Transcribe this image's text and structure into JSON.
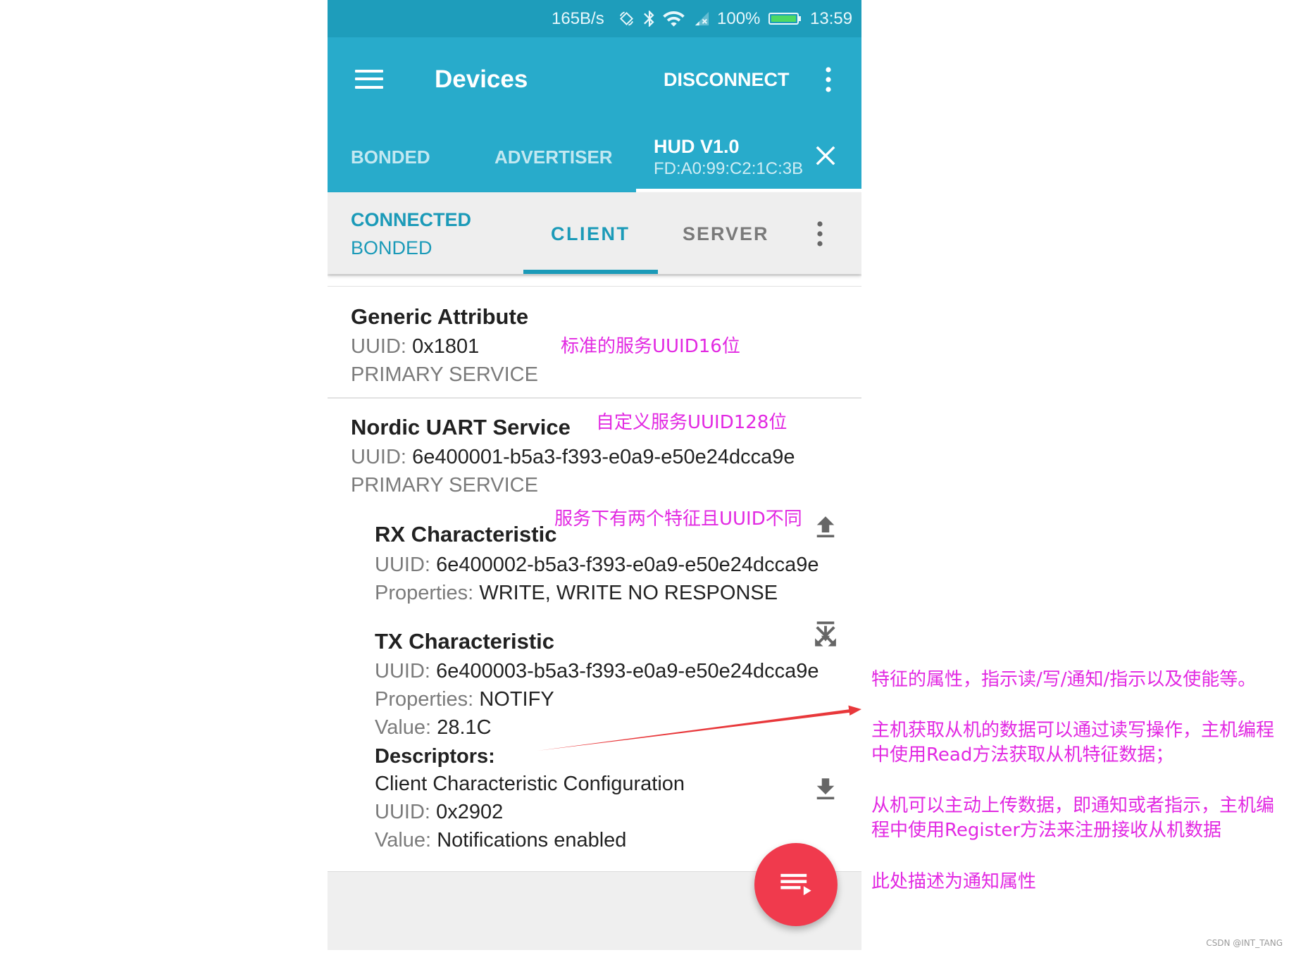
{
  "colors": {
    "status_bar": "#1e9dbb",
    "app_bar": "#28abcb",
    "accent": "#1b9ab8",
    "fab": "#f03a4d",
    "annotation": "#e229e2",
    "arrow": "#e8383b",
    "battery": "#4cd964"
  },
  "status_bar": {
    "network_speed": "165B/s",
    "battery_level": "100%",
    "time": "13:59",
    "icons": [
      "screen-rotation-icon",
      "bluetooth-icon",
      "wifi-icon",
      "cell-signal-icon",
      "battery-icon"
    ]
  },
  "toolbar": {
    "title": "Devices",
    "disconnect_label": "DISCONNECT",
    "menu_icon": "hamburger-menu-icon",
    "overflow_icon": "more-vert-icon"
  },
  "device_tabs": {
    "items": [
      {
        "label": "BONDED",
        "selected": false
      },
      {
        "label": "ADVERTISER",
        "selected": false
      }
    ],
    "active_device": {
      "name": "HUD V1.0",
      "address": "FD:A0:99:C2:1C:3B",
      "selected": true,
      "close_icon": "close-icon"
    }
  },
  "connection": {
    "state": "CONNECTED",
    "bond_state": "BONDED"
  },
  "mode_tabs": {
    "items": [
      {
        "label": "CLIENT",
        "selected": true
      },
      {
        "label": "SERVER",
        "selected": false
      }
    ],
    "overflow_icon": "more-vert-icon"
  },
  "services": [
    {
      "name": "Generic Attribute",
      "uuid_label": "UUID:",
      "uuid": "0x1801",
      "type": "PRIMARY SERVICE"
    },
    {
      "name": "Nordic UART Service",
      "uuid_label": "UUID:",
      "uuid": "6e400001-b5a3-f393-e0a9-e50e24dcca9e",
      "type": "PRIMARY SERVICE",
      "characteristics": [
        {
          "name": "RX Characteristic",
          "uuid_label": "UUID:",
          "uuid": "6e400002-b5a3-f393-e0a9-e50e24dcca9e",
          "properties_label": "Properties:",
          "properties": "WRITE, WRITE NO RESPONSE",
          "action_icon": "upload-icon"
        },
        {
          "name": "TX Characteristic",
          "uuid_label": "UUID:",
          "uuid": "6e400003-b5a3-f393-e0a9-e50e24dcca9e",
          "properties_label": "Properties:",
          "properties": "NOTIFY",
          "value_label": "Value:",
          "value": "28.1C",
          "action_icon": "notifications-toggle-icon",
          "descriptors_label": "Descriptors:",
          "descriptors": [
            {
              "name": "Client Characteristic Configuration",
              "uuid_label": "UUID:",
              "uuid": "0x2902",
              "value_label": "Value:",
              "value": "Notifications enabled",
              "action_icon": "download-icon"
            }
          ]
        }
      ]
    }
  ],
  "fab": {
    "icon": "playlist-play-icon"
  },
  "annotations": {
    "service_uuid16": "标准的服务UUID16位",
    "service_uuid128": "自定义服务UUID128位",
    "characteristics_note": "服务下有两个特征且UUID不同",
    "side_notes": [
      "特征的属性，指示读/写/通知/指示以及使能等。",
      "主机获取从机的数据可以通过读写操作，主机编程",
      "中使用Read方法获取从机特征数据；",
      "从机可以主动上传数据，即通知或者指示，主机编",
      "程中使用Register方法来注册接收从机数据",
      "此处描述为通知属性"
    ]
  },
  "watermark": "CSDN @INT_TANG"
}
